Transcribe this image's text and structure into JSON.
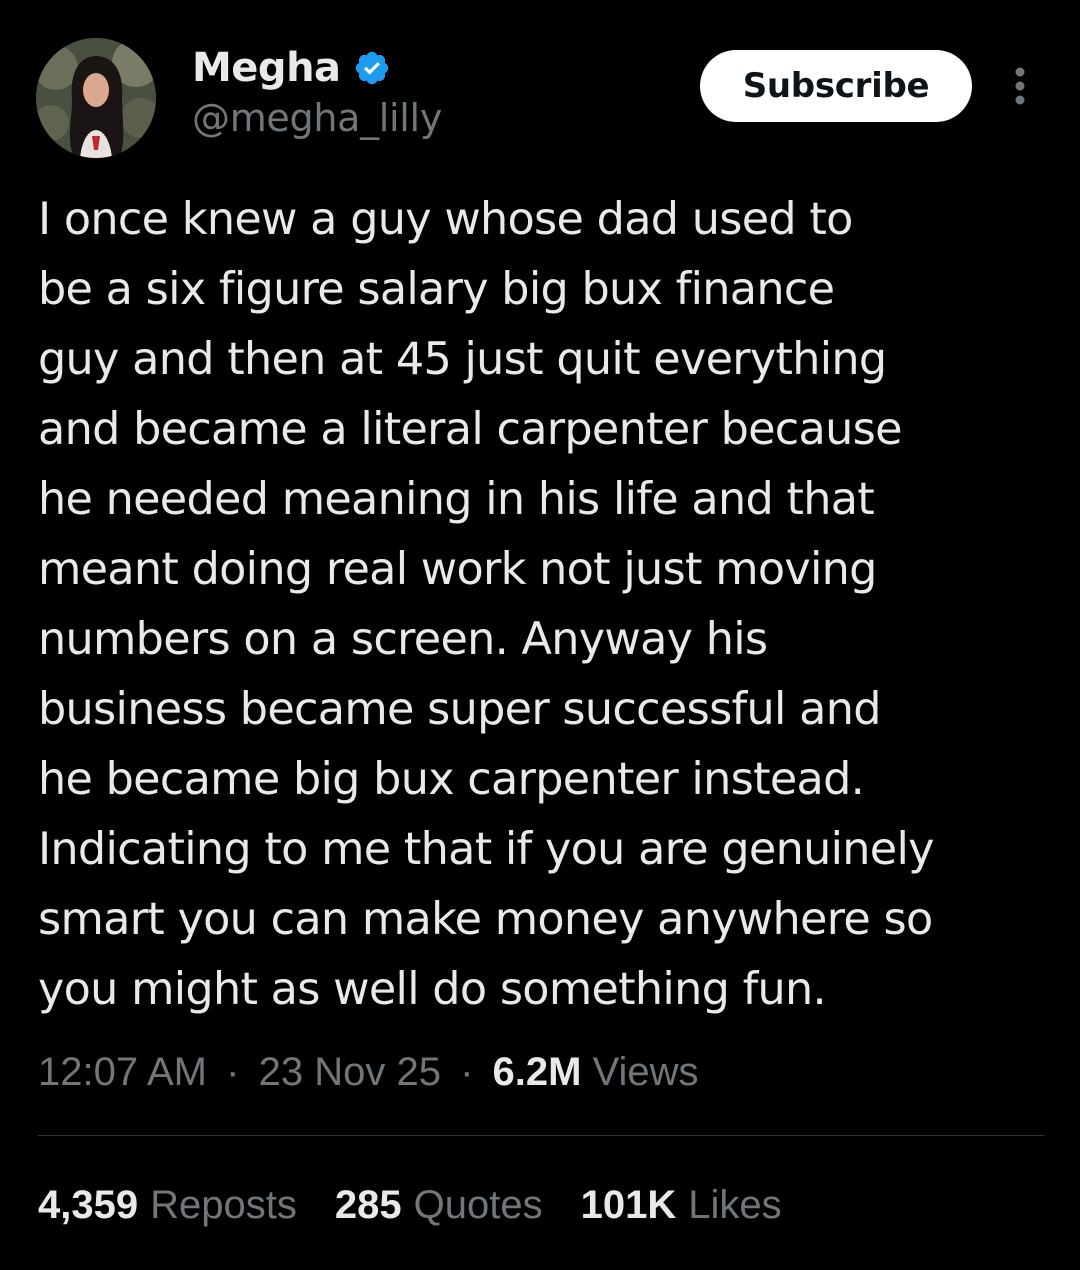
{
  "author": {
    "display_name": "Megha",
    "handle": "@megha_lilly",
    "verified": true
  },
  "header": {
    "subscribe_label": "Subscribe"
  },
  "tweet": {
    "lines": [
      "I once knew a guy whose dad used to",
      "be a six figure salary big bux finance",
      "guy and then at 45 just quit everything",
      "and became a literal carpenter because",
      "he needed meaning in his life and that",
      "meant doing real work not just moving",
      "numbers on a screen. Anyway his",
      "business became super successful and",
      "he became big bux carpenter instead.",
      "Indicating to me that if you are genuinely",
      "smart you can make money anywhere so",
      "you might as well do something fun."
    ]
  },
  "meta": {
    "time": "12:07 AM",
    "separator": "·",
    "date": "23 Nov 25",
    "views_count": "6.2M",
    "views_label": "Views"
  },
  "stats": {
    "reposts_count": "4,359",
    "reposts_label": "Reposts",
    "quotes_count": "285",
    "quotes_label": "Quotes",
    "likes_count": "101K",
    "likes_label": "Likes"
  },
  "colors": {
    "background": "#000000",
    "text_primary": "#e7e9ea",
    "text_secondary": "#71767b",
    "verified_blue": "#1d9bf0",
    "divider": "#2f3336",
    "subscribe_bg": "#ffffff"
  },
  "icons": {
    "verified": "verified-badge-icon",
    "more": "more-options-icon"
  }
}
